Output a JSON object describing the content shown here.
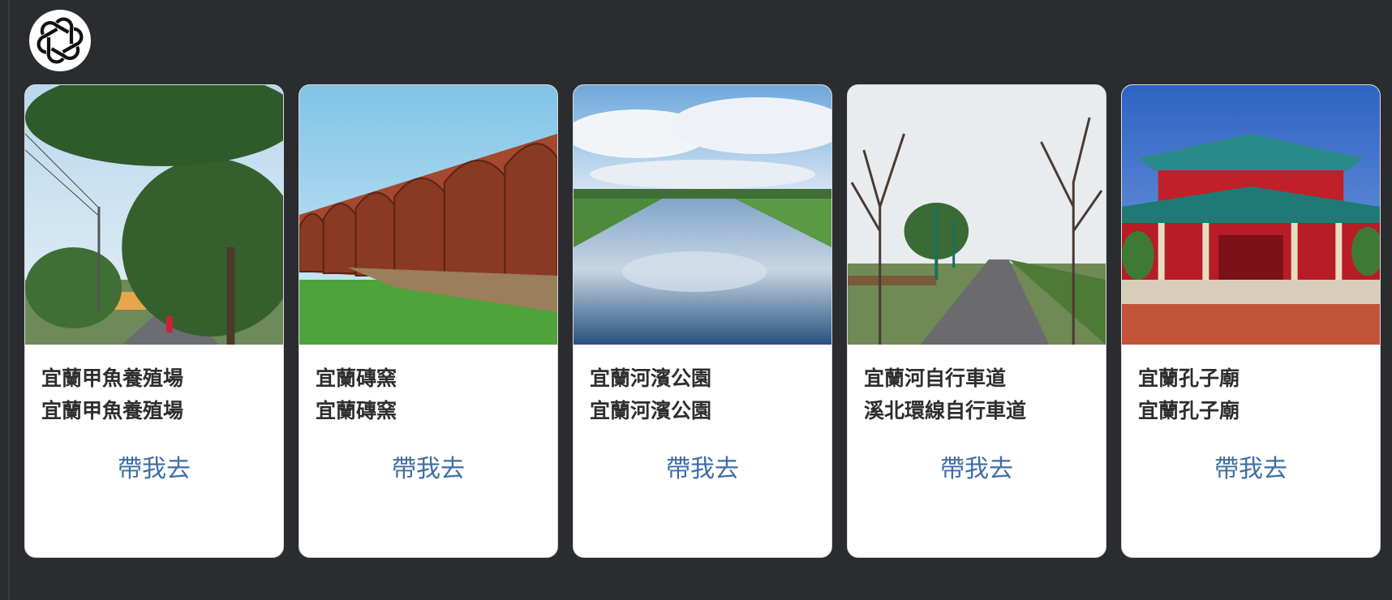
{
  "assistant": {
    "avatar_icon": "openai-logo-icon"
  },
  "cards": [
    {
      "title": "宜蘭甲魚養殖場",
      "subtitle": "宜蘭甲魚養殖場",
      "button_label": "帶我去",
      "image": "tree-lined-road-photo"
    },
    {
      "title": "宜蘭磚窯",
      "subtitle": "宜蘭磚窯",
      "button_label": "帶我去",
      "image": "brick-kiln-photo"
    },
    {
      "title": "宜蘭河濱公園",
      "subtitle": "宜蘭河濱公園",
      "button_label": "帶我去",
      "image": "river-reflection-photo"
    },
    {
      "title": "宜蘭河自行車道",
      "subtitle": "溪北環線自行車道",
      "button_label": "帶我去",
      "image": "bike-path-photo"
    },
    {
      "title": "宜蘭孔子廟",
      "subtitle": "宜蘭孔子廟",
      "button_label": "帶我去",
      "image": "confucius-temple-photo"
    }
  ]
}
